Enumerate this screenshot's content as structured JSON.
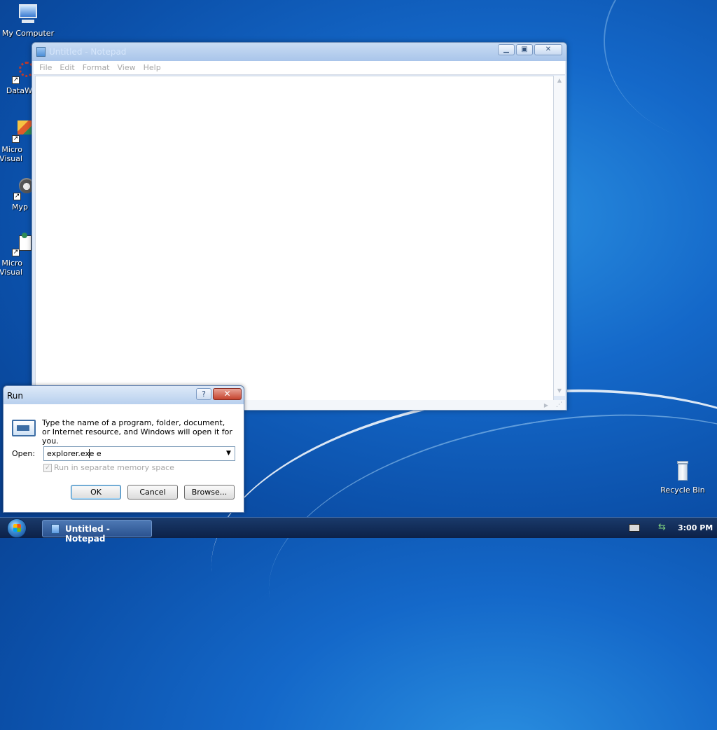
{
  "desktop": {
    "icons": [
      {
        "label": "My Computer",
        "icon": "computer-icon"
      },
      {
        "label": "DataW",
        "icon": "app-icon"
      },
      {
        "label": "Micro\nVisual",
        "icon": "visual-studio-icon"
      },
      {
        "label": "Myp",
        "icon": "raccoon-icon"
      },
      {
        "label": "Micro\nVisual",
        "icon": "visual-studio-icon"
      },
      {
        "label": "Recycle Bin",
        "icon": "recycle-bin-icon"
      }
    ]
  },
  "notepad": {
    "title": "Untitled - Notepad",
    "menu": [
      "File",
      "Edit",
      "Format",
      "View",
      "Help"
    ],
    "content": ""
  },
  "run_dialog": {
    "title": "Run",
    "help_label": "?",
    "close_label": "✕",
    "description": "Type the name of a program, folder, document, or Internet resource, and Windows will open it for you.",
    "open_label": "Open:",
    "open_value": "explorer.exe e",
    "checkbox_label": "Run in separate memory space",
    "checkbox_checked": true,
    "buttons": {
      "ok": "OK",
      "cancel": "Cancel",
      "browse": "Browse..."
    }
  },
  "taskbar": {
    "task_label": "Untitled - Notepad",
    "clock": "3:00 PM"
  },
  "colors": {
    "desktop": "#1468c9",
    "taskbar": "#0c2148",
    "dialog_face": "#ece9d8"
  }
}
